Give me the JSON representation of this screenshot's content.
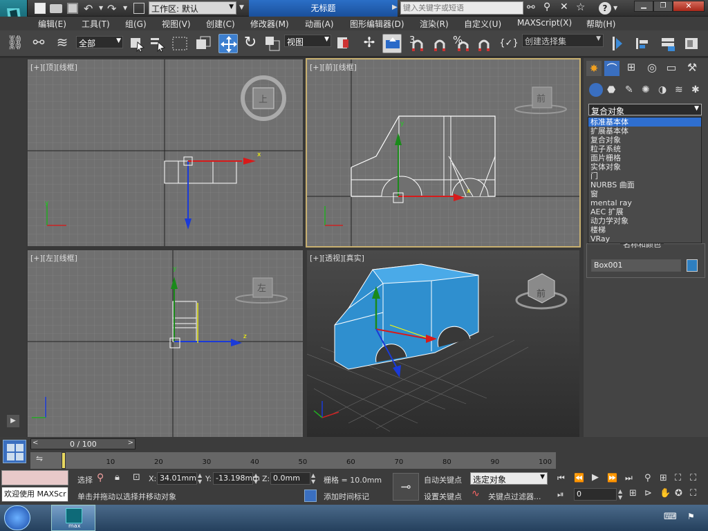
{
  "titlebar": {
    "workspace_label": "工作区: 默认",
    "doc_title": "无标题",
    "search_placeholder": "键入关键字或短语"
  },
  "menu": [
    "编辑(E)",
    "工具(T)",
    "组(G)",
    "视图(V)",
    "创建(C)",
    "修改器(M)",
    "动画(A)",
    "图形编辑器(D)",
    "渲染(R)",
    "自定义(U)",
    "MAXScript(X)",
    "帮助(H)"
  ],
  "toolbar": {
    "filter_value": "全部",
    "refcoord_value": "视图",
    "snap3": "3",
    "percent": "%",
    "named_selection_placeholder": "创建选择集"
  },
  "viewports": [
    {
      "label": "[+][顶][线框]",
      "cube": "上",
      "axis_x": "x",
      "axis_y": "y",
      "axis_z": "z"
    },
    {
      "label": "[+][前][线框]",
      "cube": "前",
      "axis_x": "x",
      "axis_y": "y",
      "axis_z": "z"
    },
    {
      "label": "[+][左][线框]",
      "cube": "左",
      "axis_x": "x",
      "axis_y": "y",
      "axis_z": "z"
    },
    {
      "label": "[+][透视][真实]",
      "cube": "前",
      "axis_x": "x",
      "axis_y": "y",
      "axis_z": "z"
    }
  ],
  "panel": {
    "category_value": "复合对象",
    "dropdown_items": [
      "标准基本体",
      "扩展基本体",
      "复合对象",
      "粒子系统",
      "面片栅格",
      "实体对象",
      "门",
      "NURBS 曲面",
      "窗",
      "mental ray",
      "AEC 扩展",
      "动力学对象",
      "楼梯",
      "VRay"
    ],
    "name_color_title": "名称和颜色",
    "object_name": "Box001",
    "object_color": "#2e7fc0"
  },
  "timeline": {
    "frame_display": "0 / 100",
    "ticks": [
      "10",
      "20",
      "30",
      "40",
      "50",
      "60",
      "70",
      "80",
      "90",
      "100"
    ],
    "ticks_pos": [
      10,
      20,
      30,
      40,
      50,
      60,
      70,
      80,
      90,
      100
    ]
  },
  "status": {
    "welcome": "欢迎使用 MAXScr",
    "select_label": "选择",
    "x_label": "X:",
    "x_value": "34.01mm",
    "y_label": "Y:",
    "y_value": "-13.198mm",
    "z_label": "Z:",
    "z_value": "0.0mm",
    "grid_label": "栅格 = 10.0mm",
    "prompt": "单击并拖动以选择并移动对象",
    "add_time_tag": "添加时间标记",
    "auto_key": "自动关键点",
    "set_key": "设置关键点",
    "key_mode_value": "选定对象",
    "key_filters": "关键点过滤器...",
    "frame_value": "0"
  },
  "taskbar": {
    "app_label": "max"
  }
}
